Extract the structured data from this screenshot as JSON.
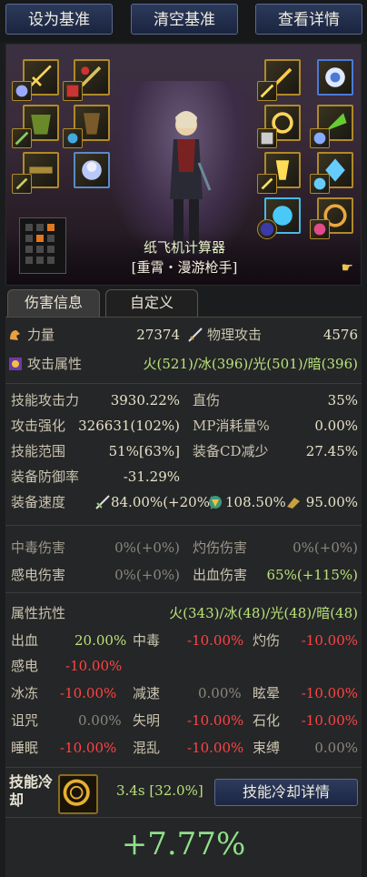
{
  "top_buttons": {
    "set_baseline": "设为基准",
    "clear_baseline": "清空基准",
    "view_details": "查看详情"
  },
  "character": {
    "name": "纸飞机计算器",
    "title": "[重霄・漫游枪手]"
  },
  "tabs": {
    "damage_info": "伤害信息",
    "custom": "自定义"
  },
  "primary": {
    "strength_label": "力量",
    "strength_value": "27374",
    "phys_attack_label": "物理攻击",
    "phys_attack_value": "4576",
    "element_label": "攻击属性",
    "element_value": "火(521)/冰(396)/光(501)/暗(396)"
  },
  "skill_stats": {
    "skill_attack_label": "技能攻击力",
    "skill_attack_value": "3930.22%",
    "direct_damage_label": "直伤",
    "direct_damage_value": "35%",
    "attack_boost_label": "攻击强化",
    "attack_boost_value": "326631(102%)",
    "mp_cost_label": "MP消耗量%",
    "mp_cost_value": "0.00%",
    "skill_range_label": "技能范围",
    "skill_range_value": "51%[63%]",
    "equip_cd_label": "装备CD减少",
    "equip_cd_value": "27.45%",
    "def_pen_label": "装备防御率",
    "def_pen_value": "-31.29%",
    "speed_label": "装备速度",
    "speed_attack_value": "84.00%(+20%)",
    "speed_cast_value": "108.50%",
    "speed_move_value": "95.00%"
  },
  "status_damage": {
    "poison_label": "中毒伤害",
    "poison_value": "0%(+0%)",
    "burn_label": "灼伤伤害",
    "burn_value": "0%(+0%)",
    "shock_label": "感电伤害",
    "shock_value": "0%(+0%)",
    "bleed_label": "出血伤害",
    "bleed_value": "65%(+115%)"
  },
  "resist": {
    "element_resist_label": "属性抗性",
    "element_resist_value": "火(343)/冰(48)/光(48)/暗(48)",
    "bleed_label": "出血",
    "bleed_value": "20.00%",
    "poison_label": "中毒",
    "poison_value": "-10.00%",
    "burn_label": "灼伤",
    "burn_value": "-10.00%",
    "shock_label": "感电",
    "shock_value": "-10.00%",
    "freeze_label": "冰冻",
    "freeze_value": "-10.00%",
    "slow_label": "减速",
    "slow_value": "0.00%",
    "stun_label": "眩晕",
    "stun_value": "-10.00%",
    "curse_label": "诅咒",
    "curse_value": "0.00%",
    "blind_label": "失明",
    "blind_value": "-10.00%",
    "stone_label": "石化",
    "stone_value": "-10.00%",
    "sleep_label": "睡眠",
    "sleep_value": "-10.00%",
    "confuse_label": "混乱",
    "confuse_value": "-10.00%",
    "bind_label": "束缚",
    "bind_value": "0.00%"
  },
  "cooldown": {
    "label": "技能冷却",
    "value": "3.4s [32.0%]",
    "details_button": "技能冷却详情"
  },
  "result": {
    "percent": "+7.77%"
  },
  "colors": {
    "positive": "#b9e27a",
    "negative": "#ff4444",
    "button_blue": "#2c3a5a",
    "gold_border": "#b08a2a"
  }
}
